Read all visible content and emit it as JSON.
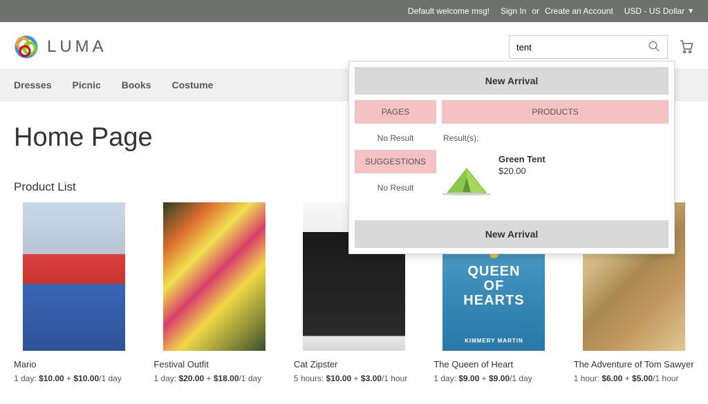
{
  "top_bar": {
    "welcome": "Default welcome msg!",
    "sign_in": "Sign In",
    "or": "or",
    "create_account": "Create an Account",
    "currency": "USD - US Dollar"
  },
  "logo": {
    "text": "LUMA"
  },
  "search": {
    "value": "tent"
  },
  "nav": {
    "items": [
      "Dresses",
      "Picnic",
      "Books",
      "Costume"
    ]
  },
  "dropdown": {
    "banner_top": "New Arrival",
    "banner_bottom": "New Arrival",
    "pages_label": "PAGES",
    "pages_result": "No Result",
    "suggestions_label": "SUGGESTIONS",
    "suggestions_result": "No Result",
    "products_label": "PRODUCTS",
    "results_label": "Result(s):",
    "product": {
      "name": "Green Tent",
      "price": "$20.00"
    }
  },
  "page": {
    "title": "Home Page",
    "section": "Product List"
  },
  "products": [
    {
      "name": "Mario",
      "price_prefix": "1 day: ",
      "price_main": "$10.00",
      "price_sep": " + ",
      "price_extra": "$10.00",
      "price_suffix": "/1 day",
      "img_class": "img-mario"
    },
    {
      "name": "Festival Outfit",
      "price_prefix": "1 day: ",
      "price_main": "$20.00",
      "price_sep": " + ",
      "price_extra": "$18.00",
      "price_suffix": "/1 day",
      "img_class": "img-festival"
    },
    {
      "name": "Cat Zipster",
      "price_prefix": "5 hours: ",
      "price_main": "$10.00",
      "price_sep": " + ",
      "price_extra": "$3.00",
      "price_suffix": "/1 hour",
      "img_class": "img-cat"
    },
    {
      "name": "The Queen of Heart",
      "price_prefix": "1 day: ",
      "price_main": "$9.00",
      "price_sep": " + ",
      "price_extra": "$9.00",
      "price_suffix": "/1 day",
      "img_class": "img-queen"
    },
    {
      "name": "The Adventure of Tom Sawyer",
      "price_prefix": "1 hour: ",
      "price_main": "$6.00",
      "price_sep": " + ",
      "price_extra": "$5.00",
      "price_suffix": "/1 hour",
      "img_class": "img-tom"
    }
  ]
}
